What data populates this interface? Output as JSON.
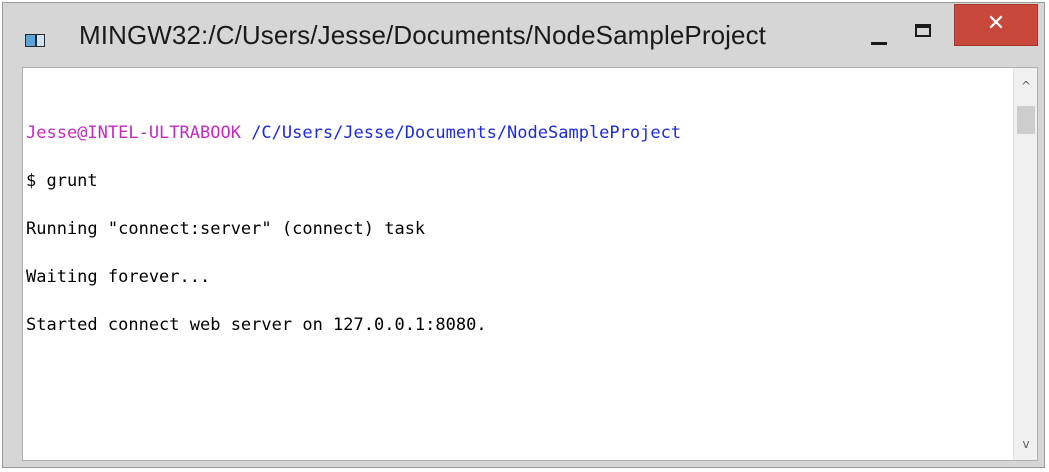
{
  "window": {
    "title": "MINGW32:/C/Users/Jesse/Documents/NodeSampleProject",
    "controls": {
      "minimize_icon": "minimize-icon",
      "maximize_icon": "maximize-icon",
      "close_label": "✕"
    }
  },
  "terminal": {
    "prompt_user_host": "Jesse@INTEL-ULTRABOOK",
    "prompt_cwd": "/C/Users/Jesse/Documents/NodeSampleProject",
    "lines": [
      "$ grunt",
      "Running \"connect:server\" (connect) task",
      "Waiting forever...",
      "Started connect web server on 127.0.0.1:8080."
    ]
  },
  "scrollbar": {
    "up_arrow": "^",
    "down_arrow": "v"
  },
  "colors": {
    "user_host": "#c22bc2",
    "cwd": "#1d2bd6",
    "close_button": "#c9483c"
  }
}
